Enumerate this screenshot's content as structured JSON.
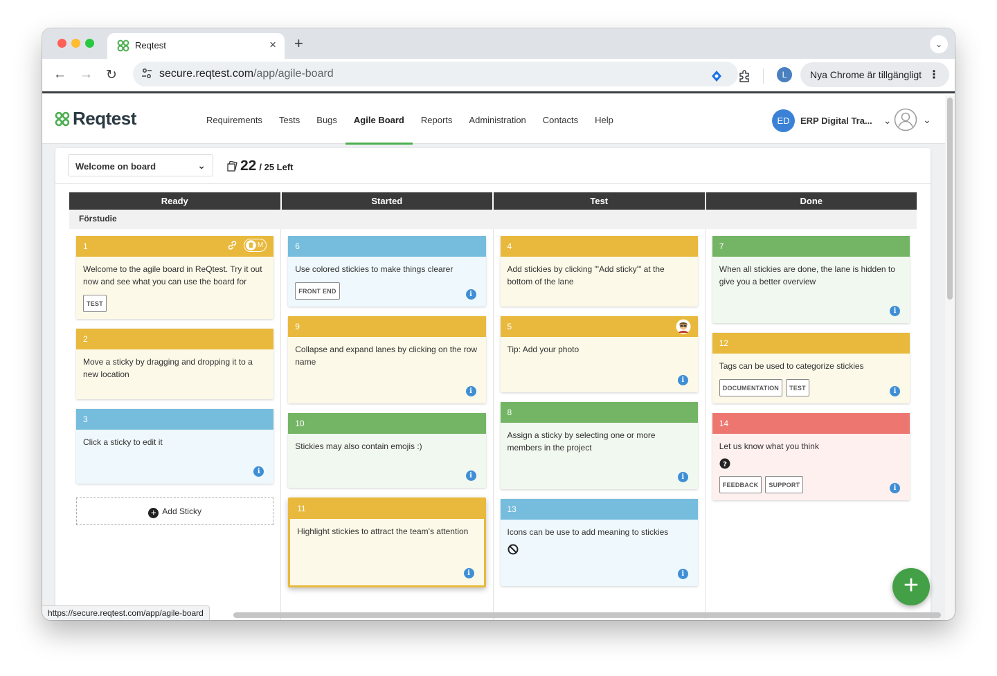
{
  "browser": {
    "tab_title": "Reqtest",
    "url_host": "secure.reqtest.com",
    "url_path": "/app/agile-board",
    "profile_initial": "L",
    "update_label": "Nya Chrome är tillgängligt",
    "status_url": "https://secure.reqtest.com/app/agile-board"
  },
  "app": {
    "logo_text": "Reqtest",
    "nav": [
      "Requirements",
      "Tests",
      "Bugs",
      "Agile Board",
      "Reports",
      "Administration",
      "Contacts",
      "Help"
    ],
    "active_nav": "Agile Board",
    "org_initials": "ED",
    "org_name": "ERP Digital Tra..."
  },
  "board": {
    "selected_board": "Welcome on board",
    "count": "22",
    "count_rest": "/ 25 Left",
    "columns": [
      "Ready",
      "Started",
      "Test",
      "Done"
    ],
    "lane": "Förstudie",
    "add_sticky_label": "Add Sticky"
  },
  "colors": {
    "yellow_head": "#e8b93c",
    "yellow_body": "#fdf9e8",
    "blue_head": "#76bcdd",
    "blue_body": "#eff8fc",
    "green_head": "#74b565",
    "green_body": "#f1f8ef",
    "red_head": "#ed7770",
    "red_body": "#fdf0ef"
  },
  "stickies": {
    "s1": {
      "id": "1",
      "text": "Welcome to the agile board in ReQtest. Try it out now and see what you can use the board for",
      "tags": [
        "TEST"
      ],
      "member": "M"
    },
    "s2": {
      "id": "2",
      "text": "Move a sticky by dragging and dropping it to a new location"
    },
    "s3": {
      "id": "3",
      "text": "Click a sticky to edit it"
    },
    "s6": {
      "id": "6",
      "text": "Use colored stickies to make things clearer",
      "tags": [
        "FRONT END"
      ]
    },
    "s9": {
      "id": "9",
      "text": "Collapse and expand lanes by clicking on the row name"
    },
    "s10": {
      "id": "10",
      "text": "Stickies may also contain emojis :)"
    },
    "s11": {
      "id": "11",
      "text": "Highlight stickies to attract the team's attention"
    },
    "s4": {
      "id": "4",
      "text": "Add stickies by clicking \"'Add sticky'\" at the bottom of the lane"
    },
    "s5": {
      "id": "5",
      "text": "Tip: Add your photo"
    },
    "s8": {
      "id": "8",
      "text": "Assign a sticky by selecting one or more members in the project"
    },
    "s13": {
      "id": "13",
      "text": "Icons can be use to add meaning to stickies"
    },
    "s7": {
      "id": "7",
      "text": "When all stickies are done, the lane is hidden to give you a better overview"
    },
    "s12": {
      "id": "12",
      "text": "Tags can be used to categorize stickies",
      "tags": [
        "DOCUMENTATION",
        "TEST"
      ]
    },
    "s14": {
      "id": "14",
      "text": "Let us know what you think",
      "tags": [
        "FEEDBACK",
        "SUPPORT"
      ]
    }
  }
}
